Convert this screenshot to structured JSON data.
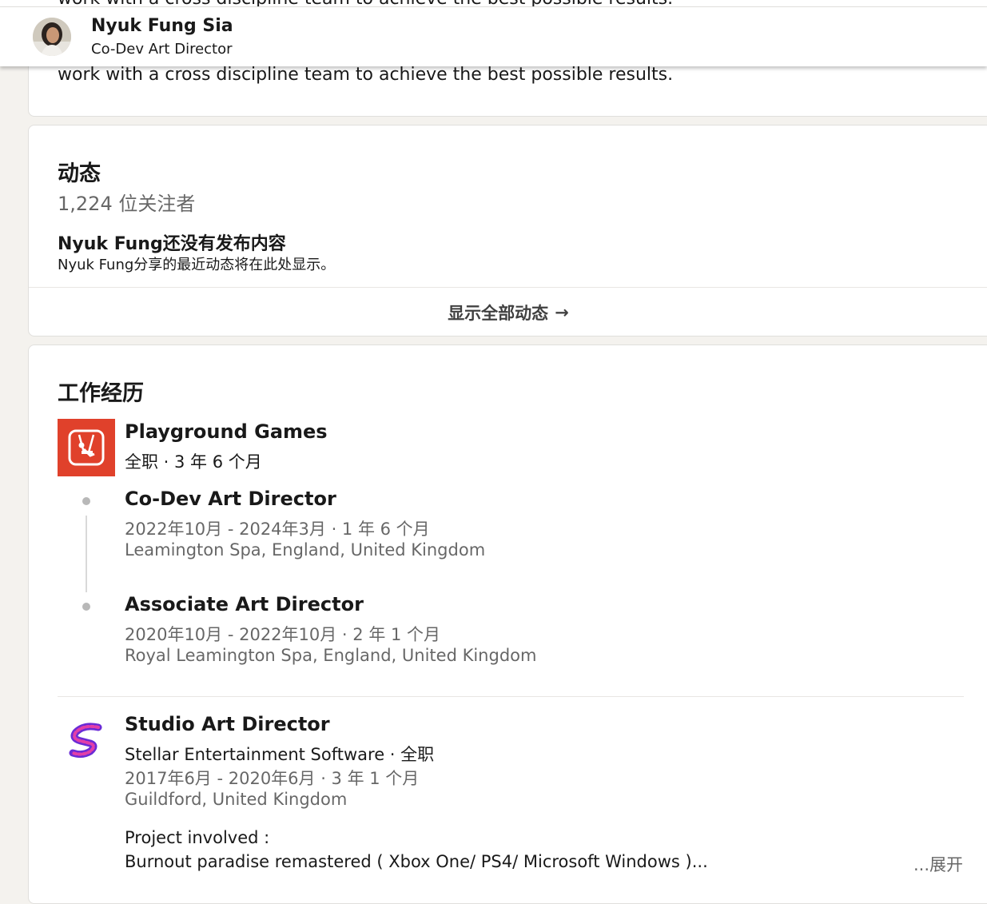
{
  "header": {
    "name": "Nyuk Fung Sia",
    "title": "Co-Dev Art Director"
  },
  "about": {
    "visible_text": "work with a cross discipline team to achieve the best possible results."
  },
  "activity": {
    "title": "动态",
    "followers": "1,224 位关注者",
    "empty_title": "Nyuk Fung还没有发布内容",
    "empty_subtitle": "Nyuk Fung分享的最近动态将在此处显示。",
    "show_all_label": "显示全部动态",
    "show_all_arrow": "→"
  },
  "experience": {
    "title": "工作经历",
    "companies": [
      {
        "name": "Playground Games",
        "summary": "全职 · 3 年 6 个月",
        "logo_icon": "playground-games-swing-icon",
        "logo_color": "#e0412b",
        "roles": [
          {
            "title": "Co-Dev Art Director",
            "dates": "2022年10月 - 2024年3月 · 1 年 6 个月",
            "location": "Leamington Spa, England, United Kingdom"
          },
          {
            "title": "Associate Art Director",
            "dates": "2020年10月 - 2022年10月 · 2 年 1 个月",
            "location": "Royal Leamington Spa, England, United Kingdom"
          }
        ]
      },
      {
        "title": "Studio Art Director",
        "company_line": "Stellar Entertainment Software · 全职",
        "dates": "2017年6月 - 2020年6月 · 3 年 1 个月",
        "location": "Guildford, United Kingdom",
        "logo_icon": "stellar-entertainment-logo-icon",
        "description_line1": "Project involved :",
        "description_line2": "Burnout paradise remastered ( Xbox One/ PS4/ Microsoft Windows )...",
        "see_more": "...展开"
      }
    ]
  },
  "colors": {
    "page_background": "#f4f2ee",
    "card_background": "#ffffff",
    "text_primary": "#000000e6",
    "text_secondary": "#00000099",
    "timeline_dot": "#b8b8b8"
  }
}
